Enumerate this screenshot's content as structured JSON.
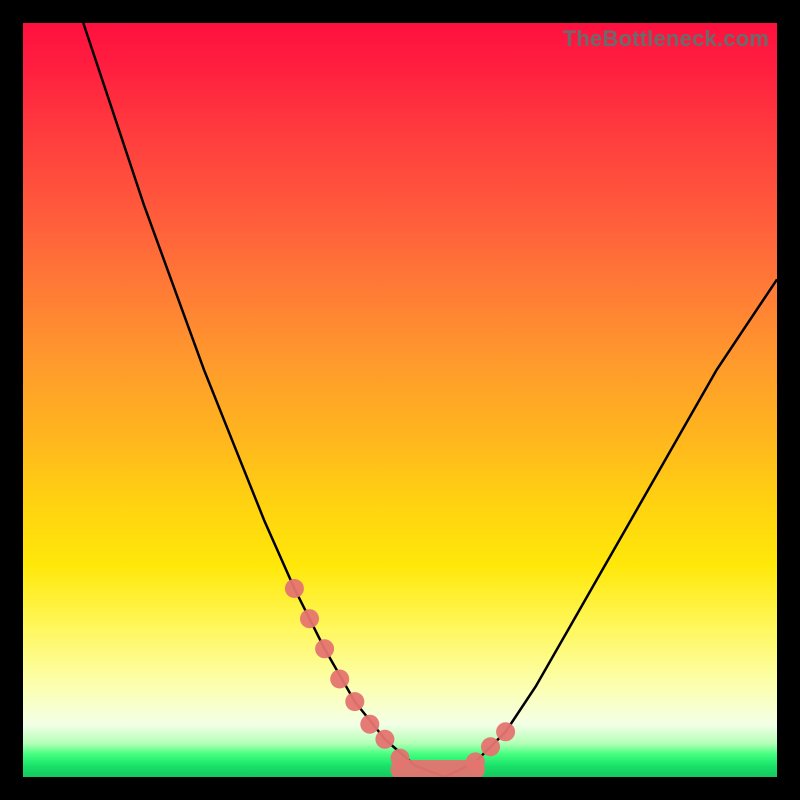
{
  "watermark": "TheBottleneck.com",
  "chart_data": {
    "type": "line",
    "title": "",
    "xlabel": "",
    "ylabel": "",
    "xlim": [
      0,
      100
    ],
    "ylim": [
      0,
      100
    ],
    "series": [
      {
        "name": "bottleneck-curve",
        "x": [
          8,
          12,
          16,
          20,
          24,
          28,
          32,
          36,
          40,
          44,
          48,
          52,
          56,
          60,
          64,
          68,
          72,
          76,
          80,
          84,
          88,
          92,
          96,
          100
        ],
        "y": [
          100,
          88,
          76,
          65,
          54,
          44,
          34,
          25,
          17,
          10,
          5,
          1.5,
          0,
          2,
          6,
          12,
          19,
          26,
          33,
          40,
          47,
          54,
          60,
          66
        ]
      }
    ],
    "markers": {
      "name": "highlighted-points",
      "x": [
        36,
        38,
        40,
        42,
        44,
        46,
        48,
        50,
        52,
        54,
        56,
        58,
        60,
        62,
        64
      ],
      "y": [
        25,
        21,
        17,
        13,
        10,
        7,
        5,
        2.5,
        1.5,
        0.7,
        0,
        1,
        2,
        4,
        6
      ]
    },
    "gradient_stops": [
      {
        "pos": 0.0,
        "color": "#ff103f"
      },
      {
        "pos": 0.25,
        "color": "#ff5a3c"
      },
      {
        "pos": 0.55,
        "color": "#ffb61e"
      },
      {
        "pos": 0.8,
        "color": "#fff75a"
      },
      {
        "pos": 0.93,
        "color": "#f3ffe6"
      },
      {
        "pos": 0.97,
        "color": "#43ff7e"
      },
      {
        "pos": 1.0,
        "color": "#16c85f"
      }
    ]
  }
}
